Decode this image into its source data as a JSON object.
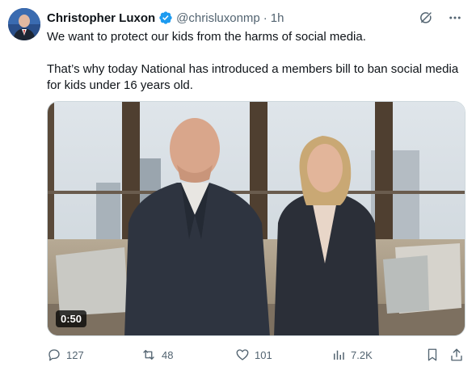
{
  "author": {
    "name": "Christopher Luxon",
    "handle": "@chrisluxonmp",
    "separator": "·",
    "time": "1h"
  },
  "body": {
    "paragraph_1": "We want to protect our kids from the harms of social media.",
    "paragraph_2": "That’s why today National has introduced a members bill to ban social media for kids under 16 years old."
  },
  "media": {
    "duration": "0:50"
  },
  "actions": {
    "replies": "127",
    "reposts": "48",
    "likes": "101",
    "views": "7.2K"
  },
  "icons": {
    "verified": "verified-badge-icon",
    "grok": "grok-icon",
    "more": "more-icon",
    "reply": "reply-icon",
    "repost": "repost-icon",
    "like": "like-icon",
    "views": "views-icon",
    "bookmark": "bookmark-icon",
    "share": "share-icon"
  },
  "colors": {
    "text": "#0f1419",
    "secondary": "#536471",
    "verified": "#1d9bf0"
  }
}
